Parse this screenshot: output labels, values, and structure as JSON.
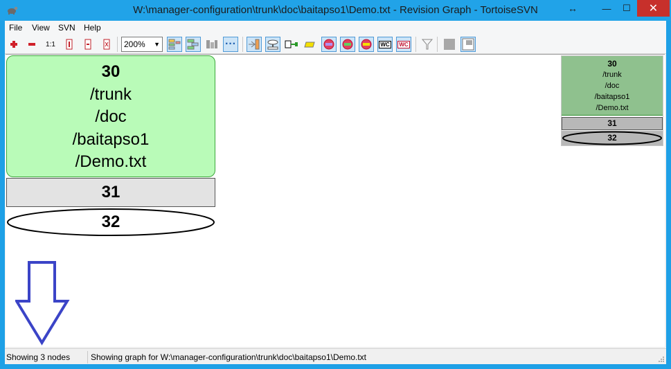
{
  "window": {
    "title": "W:\\manager-configuration\\trunk\\doc\\baitapso1\\Demo.txt - Revision Graph - TortoiseSVN",
    "resize_glyph": "↔",
    "minimize_glyph": "—",
    "maximize_glyph": "☐",
    "close_glyph": "✕"
  },
  "menu": {
    "file": "File",
    "view": "View",
    "svn": "SVN",
    "help": "Help"
  },
  "toolbar": {
    "zoom_value": "200%",
    "zoom_in_icon": "plus-icon",
    "zoom_out_icon": "minus-icon",
    "zoom_original_label": "1:1",
    "more_label": "···",
    "wc_label": "WC"
  },
  "graph": {
    "node30": {
      "revision": "30",
      "path_lines": [
        "/trunk",
        "/doc",
        "/baitapso1",
        "/Demo.txt"
      ]
    },
    "node31": {
      "revision": "31"
    },
    "node32": {
      "revision": "32"
    }
  },
  "overview": {
    "node30": {
      "revision": "30",
      "path_lines": [
        "/trunk",
        "/doc",
        "/baitapso1",
        "/Demo.txt"
      ]
    },
    "node31": {
      "revision": "31"
    },
    "node32": {
      "revision": "32"
    }
  },
  "statusbar": {
    "node_count_text": "Showing 3 nodes",
    "path_text": "Showing graph for W:\\manager-configuration\\trunk\\doc\\baitapso1\\Demo.txt"
  },
  "colors": {
    "added_node_fill": "#b9fbb8",
    "added_node_border": "#3aa63a",
    "modified_node_fill": "#e3e3e3",
    "annotation_arrow": "#3b44c7",
    "titlebar": "#21a3e8",
    "close_button": "#c7302b"
  }
}
